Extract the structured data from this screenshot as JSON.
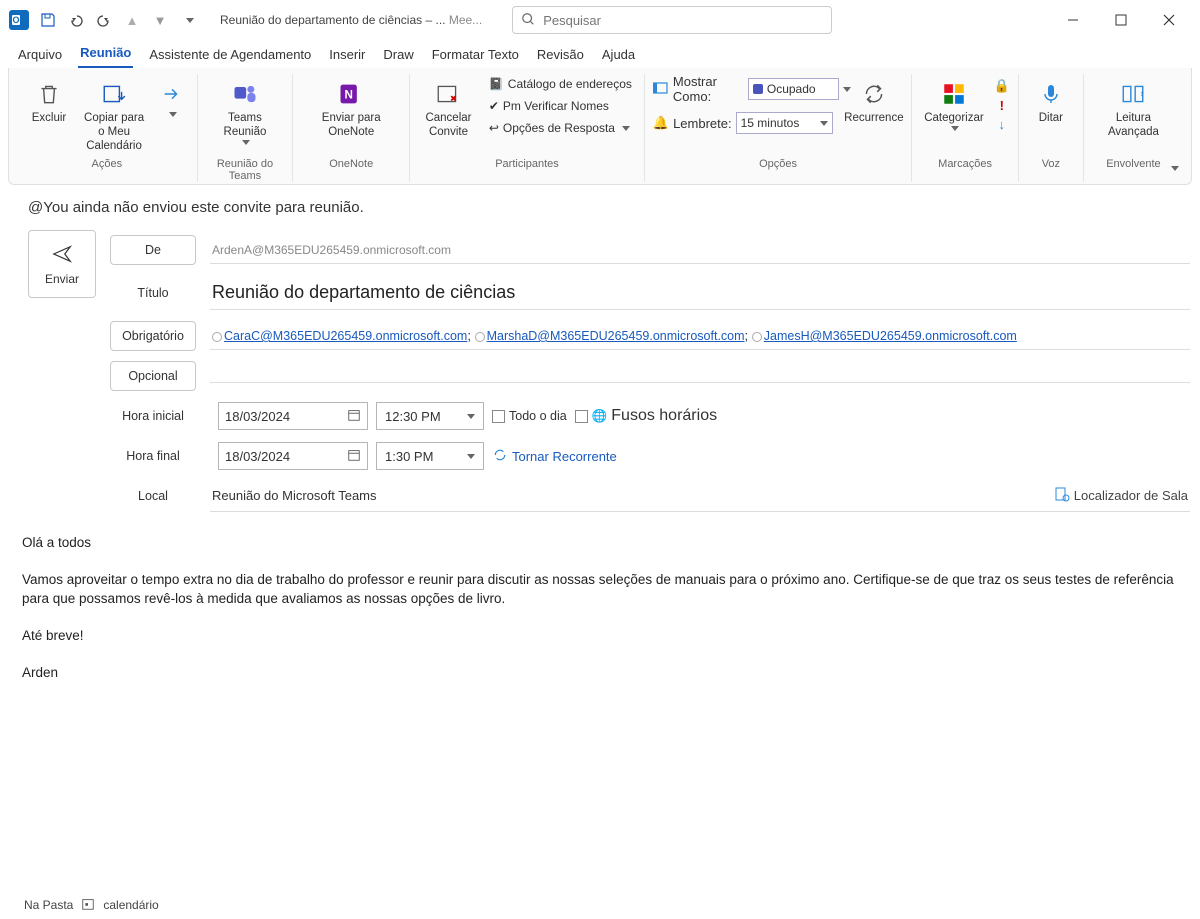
{
  "titlebar": {
    "window_title": "Reunião do departamento de ciências – ...",
    "msg_tag": "Mee...",
    "search_placeholder": "Pesquisar"
  },
  "tabs": {
    "arquivo": "Arquivo",
    "reuniao": "Reunião",
    "assistente": "Assistente de Agendamento",
    "inserir": "Inserir",
    "draw": "Draw",
    "formatar": "Formatar Texto",
    "revisao": "Revisão",
    "ajuda": "Ajuda"
  },
  "ribbon": {
    "acoes": {
      "excluir": "Excluir",
      "copiar": "Copiar para o Meu Calendário",
      "groupname": "Ações"
    },
    "teams": {
      "btn": "Teams Reunião",
      "groupname": "Reunião do Teams"
    },
    "onenote": {
      "btn": "Enviar para OneNote",
      "groupname": "OneNote"
    },
    "participantes": {
      "cancel": "Cancelar Convite",
      "catalogo": "Catálogo de endereços",
      "verificar": "Pm Verificar Nomes",
      "respostas": "Opções de Resposta",
      "groupname": "Participantes"
    },
    "opcoes": {
      "mostrar_como": "Mostrar Como:",
      "mostrar_como_val": "Ocupado",
      "lembrete": "Lembrete:",
      "lembrete_val": "15 minutos",
      "recurrence": "Recurrence",
      "groupname": "Opções"
    },
    "marcacoes": {
      "categorizar": "Categorizar",
      "groupname": "Marcações"
    },
    "voz": {
      "ditar": "Ditar",
      "groupname": "Voz"
    },
    "envolvente": {
      "leitura": "Leitura Avançada",
      "groupname": "Envolvente"
    }
  },
  "infobar": "@You ainda não enviou este convite para reunião.",
  "send_label": "Enviar",
  "labels": {
    "de": "De",
    "titulo": "Título",
    "obrigatorio": "Obrigatório",
    "opcional": "Opcional",
    "hora_inicial": "Hora inicial",
    "hora_final": "Hora final",
    "local": "Local"
  },
  "form": {
    "from": "ArdenA@M365EDU265459.onmicrosoft.com",
    "title": "Reunião do departamento de ciências",
    "required": [
      "CaraC@M365EDU265459.onmicrosoft.com",
      "MarshaD@M365EDU265459.onmicrosoft.com",
      "JamesH@M365EDU265459.onmicrosoft.com"
    ],
    "optional": "",
    "start_date": "18/03/2024",
    "start_time": "12:30 PM",
    "end_date": "18/03/2024",
    "end_time": "1:30 PM",
    "allday": "Todo o dia",
    "tz": "Fusos horários",
    "make_recurring": "Tornar Recorrente",
    "location": "Reunião do Microsoft Teams",
    "room_finder": "Localizador de Sala"
  },
  "body": {
    "p1": "Olá a todos",
    "p2": "Vamos aproveitar o tempo extra no dia de trabalho do professor e reunir para discutir as nossas seleções de manuais para o próximo ano. Certifique-se de que traz os seus testes de referência para que possamos revê-los à medida que avaliamos as nossas opções de livro.",
    "p3": "Até breve!",
    "p4": "Arden"
  },
  "statusbar": {
    "na_pasta": "Na Pasta",
    "calendario": "calendário"
  }
}
